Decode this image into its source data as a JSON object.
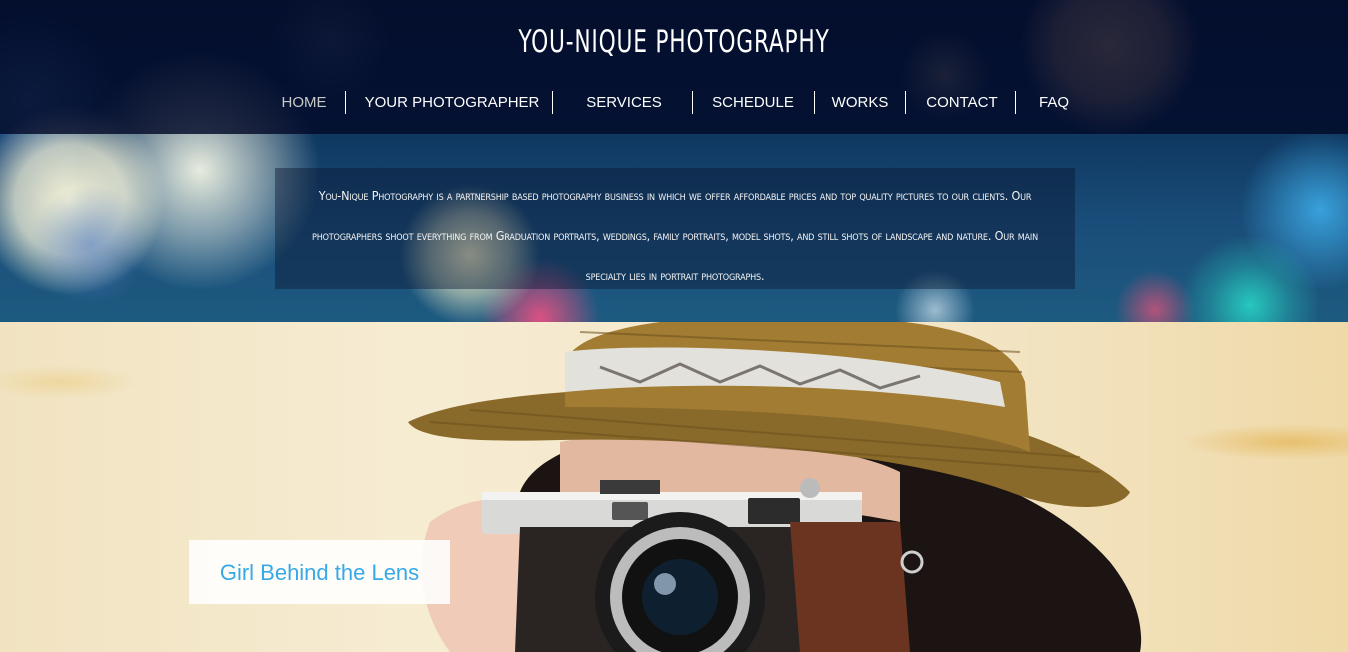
{
  "site": {
    "title": "YOU-NIQUE PHOTOGRAPHY"
  },
  "nav": {
    "items": [
      {
        "label": "HOME",
        "active": true
      },
      {
        "label": "YOUR PHOTOGRAPHER",
        "active": false
      },
      {
        "label": "SERVICES",
        "active": false
      },
      {
        "label": "SCHEDULE",
        "active": false
      },
      {
        "label": "WORKS",
        "active": false
      },
      {
        "label": "CONTACT",
        "active": false
      },
      {
        "label": "FAQ",
        "active": false
      }
    ]
  },
  "intro": {
    "text": "You-Nique Photography is a partnership based photography business in which we offer affordable prices and top quality pictures to our clients. Our photographers shoot everything from Graduation portraits, weddings, family portraits, model shots, and still shots of landscape and nature. Our main specialty lies in portrait photographs."
  },
  "feature": {
    "caption": "Girl Behind the Lens"
  },
  "colors": {
    "header_bg": "#020a28",
    "nav_active": "#c9c9c9",
    "nav_text": "#ffffff",
    "caption_text": "#37a9e6"
  }
}
